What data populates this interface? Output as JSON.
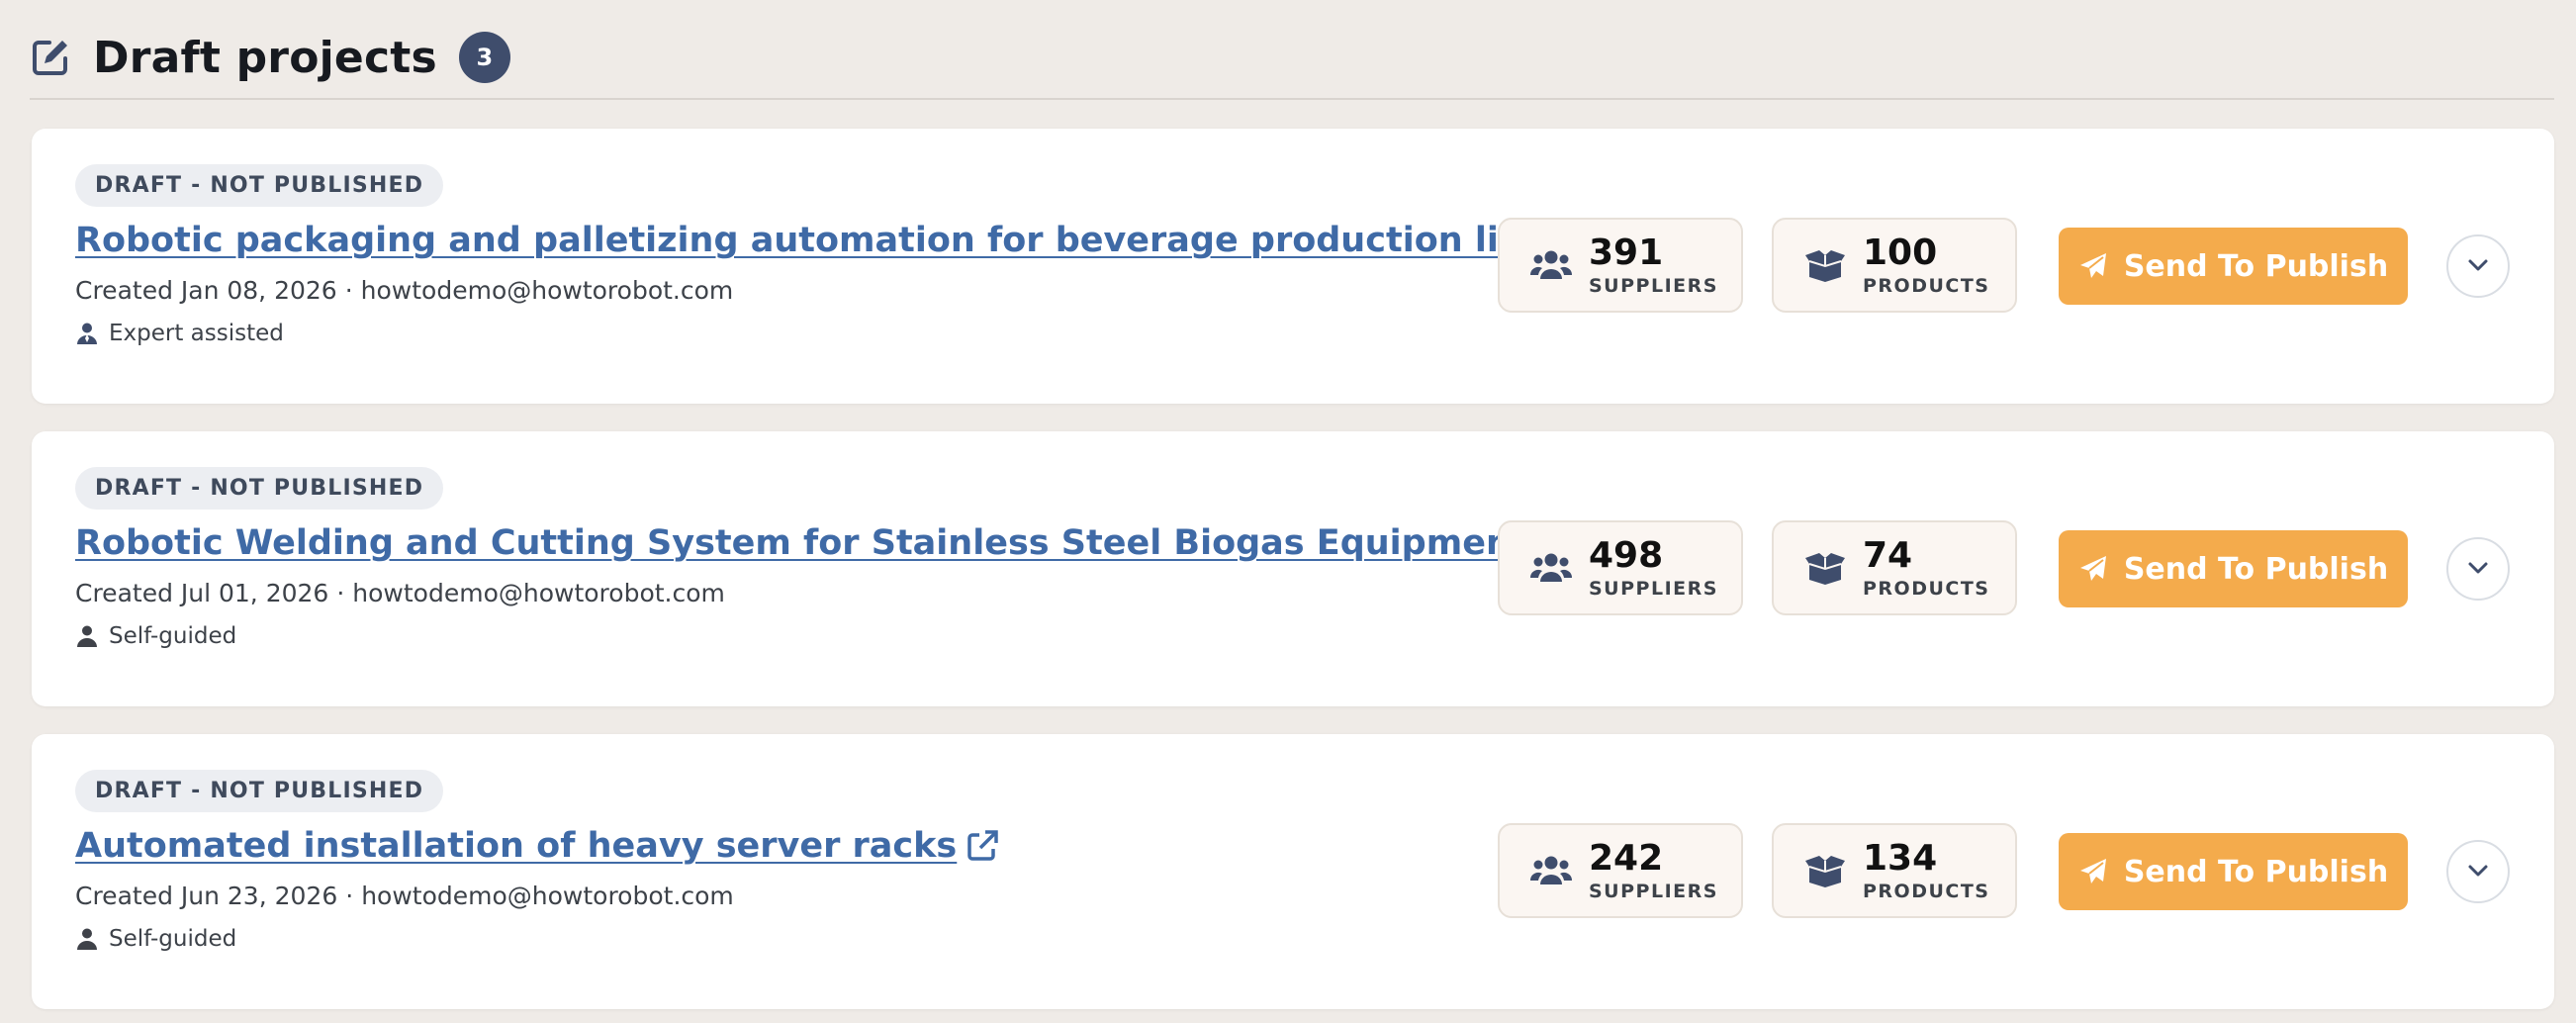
{
  "header": {
    "icon": "edit-icon",
    "title": "Draft projects",
    "count": "3"
  },
  "colors": {
    "background": "#efebe7",
    "link": "#3f6aa6",
    "accent": "#f4ab4c",
    "badge": "#3f4d6c"
  },
  "projects": [
    {
      "status": "DRAFT - NOT PUBLISHED",
      "title": "Robotic packaging and palletizing automation for beverage production line",
      "created": "Created Jan 08, 2026",
      "email": "howtodemo@howtorobot.com",
      "guidance": "Expert assisted",
      "guidance_icon": "expert-user-icon",
      "suppliers": "391",
      "suppliers_label": "SUPPLIERS",
      "products": "100",
      "products_label": "PRODUCTS",
      "publish_label": "Send To Publish"
    },
    {
      "status": "DRAFT - NOT PUBLISHED",
      "title": "Robotic Welding and Cutting System for Stainless Steel Biogas Equipment",
      "created": "Created Jul 01, 2026",
      "email": "howtodemo@howtorobot.com",
      "guidance": "Self-guided",
      "guidance_icon": "user-icon",
      "suppliers": "498",
      "suppliers_label": "SUPPLIERS",
      "products": "74",
      "products_label": "PRODUCTS",
      "publish_label": "Send To Publish"
    },
    {
      "status": "DRAFT - NOT PUBLISHED",
      "title": "Automated installation of heavy server racks",
      "created": "Created Jun 23, 2026",
      "email": "howtodemo@howtorobot.com",
      "guidance": "Self-guided",
      "guidance_icon": "user-icon",
      "suppliers": "242",
      "suppliers_label": "SUPPLIERS",
      "products": "134",
      "products_label": "PRODUCTS",
      "publish_label": "Send To Publish"
    }
  ]
}
